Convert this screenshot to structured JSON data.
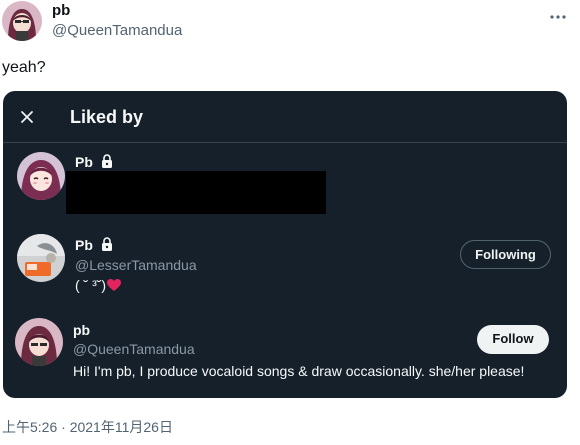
{
  "tweet": {
    "author_name": "pb",
    "author_handle": "@QueenTamandua",
    "text": "yeah?",
    "more_icon": "more-horizontal-icon",
    "timestamp": "上午5:26 · 2021年11月26日"
  },
  "modal": {
    "title": "Liked by",
    "close_icon": "close-icon",
    "users": [
      {
        "name": "Pb",
        "locked": true,
        "handle": "",
        "bio": "",
        "button": ""
      },
      {
        "name": "Pb",
        "locked": true,
        "handle": "@LesserTamandua",
        "bio": "( ˘ ³˘)",
        "button": "Following"
      },
      {
        "name": "pb",
        "locked": false,
        "handle": "@QueenTamandua",
        "bio": "Hi! I'm pb, I produce vocaloid songs & draw occasionally. she/her please!",
        "button": "Follow"
      }
    ]
  },
  "colors": {
    "card_bg": "#15202b",
    "divider": "#38444d",
    "heart": "#f91880",
    "handle_gray": "#8b98a5"
  }
}
